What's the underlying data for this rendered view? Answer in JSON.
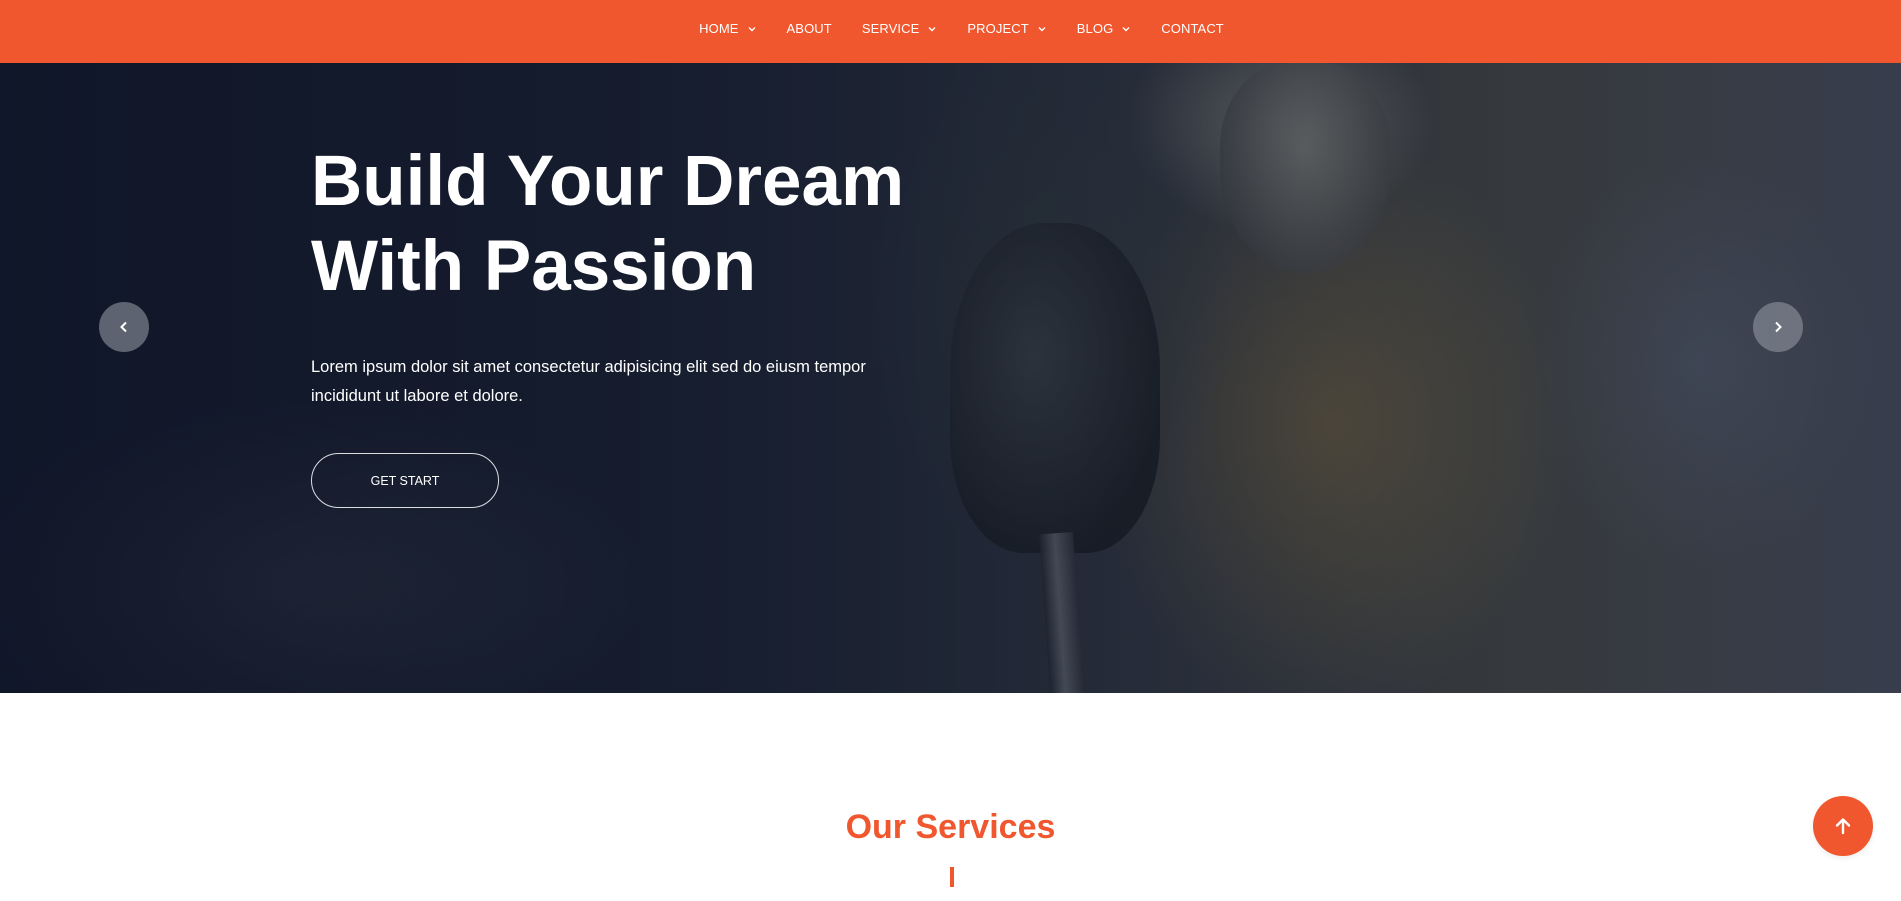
{
  "nav": {
    "items": [
      {
        "label": "HOME",
        "has_dropdown": true,
        "icon": "chevron-down-icon"
      },
      {
        "label": "ABOUT",
        "has_dropdown": false
      },
      {
        "label": "SERVICE",
        "has_dropdown": true,
        "icon": "chevron-down-icon"
      },
      {
        "label": "PROJECT",
        "has_dropdown": true,
        "icon": "chevron-down-icon"
      },
      {
        "label": "BLOG",
        "has_dropdown": true,
        "icon": "chevron-down-icon"
      },
      {
        "label": "CONTACT",
        "has_dropdown": false
      }
    ]
  },
  "hero": {
    "title_line1": "Build Your Dream",
    "title_line2": "With Passion",
    "text_line1": "Lorem ipsum dolor sit amet consectetur adipisicing elit sed do eiusm tempor",
    "text_line2": "incididunt ut labore et dolore.",
    "button_label": "GET START",
    "prev_icon": "chevron-left-icon",
    "next_icon": "chevron-right-icon"
  },
  "services": {
    "title": "Our Services"
  },
  "back_to_top": {
    "icon": "arrow-up-icon"
  },
  "colors": {
    "accent": "#F0572F",
    "white": "#FFFFFF",
    "hero_overlay": "#0E1426"
  }
}
